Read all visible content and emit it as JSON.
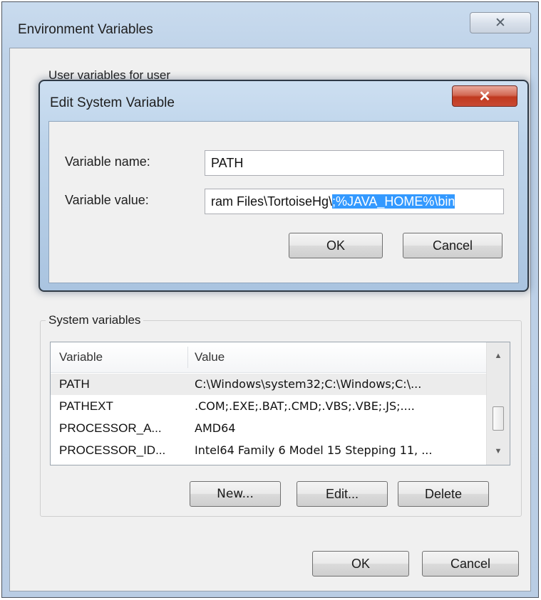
{
  "outer_window": {
    "title": "Environment Variables",
    "close_glyph": "✕",
    "user_variables_label": "User variables for user",
    "system_group": {
      "title": "System variables",
      "columns": [
        "Variable",
        "Value"
      ],
      "rows": [
        {
          "variable": "PATH",
          "value": "C:\\Windows\\system32;C:\\Windows;C:\\..."
        },
        {
          "variable": "PATHEXT",
          "value": ".COM;.EXE;.BAT;.CMD;.VBS;.VBE;.JS;...."
        },
        {
          "variable": "PROCESSOR_A...",
          "value": "AMD64"
        },
        {
          "variable": "PROCESSOR_ID...",
          "value": "Intel64 Family 6 Model 15 Stepping 11, ..."
        }
      ],
      "buttons": {
        "new": "New...",
        "edit": "Edit...",
        "delete": "Delete"
      }
    },
    "buttons": {
      "ok": "OK",
      "cancel": "Cancel"
    }
  },
  "edit_dialog": {
    "title": "Edit System Variable",
    "close_glyph": "✕",
    "name_label": "Variable name:",
    "name_value": "PATH",
    "value_label": "Variable value:",
    "value_prefix": "ram Files\\TortoiseHg\\",
    "value_selected": ";%JAVA_HOME%\\bin",
    "buttons": {
      "ok": "OK",
      "cancel": "Cancel"
    }
  },
  "colors": {
    "selection": "#3399ff",
    "close_button_red": "#c0391f",
    "title_bar_blue": "#bcd3ea"
  },
  "icons": {
    "outer_close": "close-icon",
    "inner_close": "close-icon",
    "scroll_up": "triangle-up",
    "scroll_down": "triangle-down"
  }
}
